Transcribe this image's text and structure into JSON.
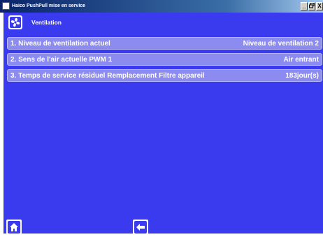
{
  "window": {
    "title": "Haico PushPull mise en service",
    "controls": [
      "_",
      "2&",
      "X"
    ]
  },
  "header": {
    "icon": "fan-icon",
    "title": "Ventilation"
  },
  "rows": [
    {
      "label": "1. Niveau de ventilation actuel",
      "value": "Niveau de ventilation 2"
    },
    {
      "label": "2. Sens de l'air actuelle PWM 1",
      "value": "Air entrant"
    },
    {
      "label": "3. Temps de service résiduel Remplacement Filtre appareil",
      "value": "183jour(s)"
    }
  ],
  "footer": {
    "home_icon": "home-icon",
    "back_icon": "back-arrow-icon"
  },
  "colors": {
    "background": "#3a3aef",
    "row": "#8b8bf0",
    "text": "#ffffff"
  }
}
